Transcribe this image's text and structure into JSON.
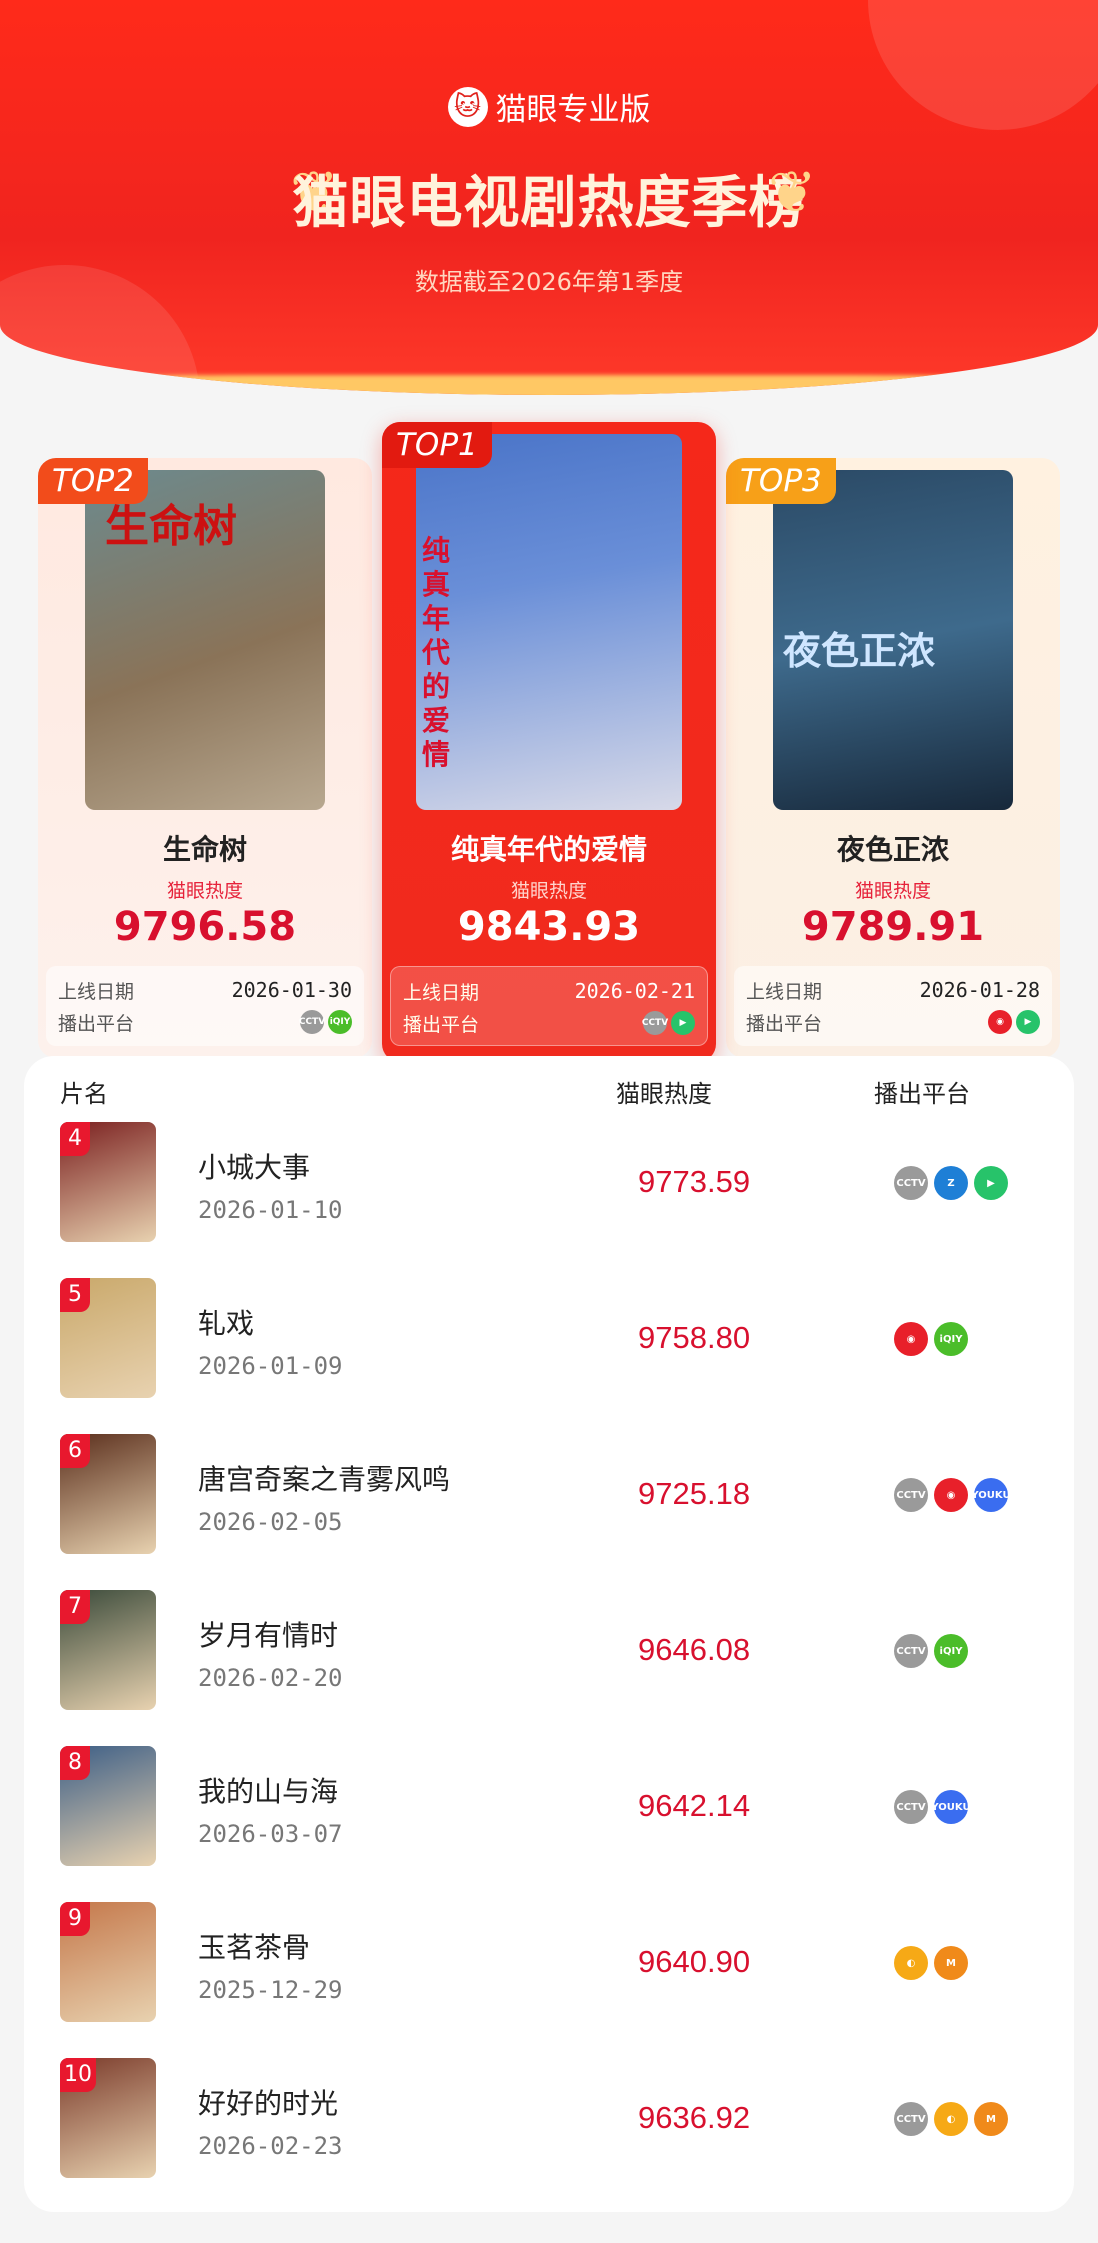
{
  "header": {
    "brand": "猫眼专业版",
    "title": "猫眼电视剧热度季榜",
    "subtitle": "数据截至2026年第1季度"
  },
  "labels": {
    "heat": "猫眼热度",
    "release_date": "上线日期",
    "platform": "播出平台",
    "col_name": "片名",
    "col_heat": "猫眼热度",
    "col_platform": "播出平台"
  },
  "top": [
    {
      "tag": "TOP1",
      "name": "纯真年代的爱情",
      "heat": "9843.93",
      "date": "2026-02-21",
      "poster_text": "纯真年代的爱情",
      "platforms": [
        "cctv-icon",
        "tencent-video-icon"
      ]
    },
    {
      "tag": "TOP2",
      "name": "生命树",
      "heat": "9796.58",
      "date": "2026-01-30",
      "poster_text": "生命树",
      "platforms": [
        "cctv-icon",
        "iqiyi-icon"
      ]
    },
    {
      "tag": "TOP3",
      "name": "夜色正浓",
      "heat": "9789.91",
      "date": "2026-01-28",
      "poster_text": "夜色正浓",
      "platforms": [
        "mgtv-red-icon",
        "tencent-video-icon"
      ]
    }
  ],
  "rows": [
    {
      "rank": "4",
      "name": "小城大事",
      "date": "2026-01-10",
      "heat": "9773.59",
      "platforms": [
        "cctv-icon",
        "zhejiang-tv-icon",
        "tencent-video-icon"
      ],
      "thumb": "#7a1f1f"
    },
    {
      "rank": "5",
      "name": "轧戏",
      "date": "2026-01-09",
      "heat": "9758.80",
      "platforms": [
        "mgtv-red-icon",
        "iqiyi-icon"
      ],
      "thumb": "#c9a86a"
    },
    {
      "rank": "6",
      "name": "唐宫奇案之青雾风鸣",
      "date": "2026-02-05",
      "heat": "9725.18",
      "platforms": [
        "cctv-icon",
        "mgtv-red-icon",
        "youku-icon"
      ],
      "thumb": "#5a2e1c"
    },
    {
      "rank": "7",
      "name": "岁月有情时",
      "date": "2026-02-20",
      "heat": "9646.08",
      "platforms": [
        "cctv-icon",
        "iqiyi-icon"
      ],
      "thumb": "#3a4a3a"
    },
    {
      "rank": "8",
      "name": "我的山与海",
      "date": "2026-03-07",
      "heat": "9642.14",
      "platforms": [
        "cctv-icon",
        "youku-icon"
      ],
      "thumb": "#3c5e86"
    },
    {
      "rank": "9",
      "name": "玉茗茶骨",
      "date": "2025-12-29",
      "heat": "9640.90",
      "platforms": [
        "hunan-tv-icon",
        "mango-tv-icon"
      ],
      "thumb": "#c4774a"
    },
    {
      "rank": "10",
      "name": "好好的时光",
      "date": "2026-02-23",
      "heat": "9636.92",
      "platforms": [
        "cctv-icon",
        "hunan-tv-icon",
        "mango-tv-icon"
      ],
      "thumb": "#7a3a2a"
    }
  ],
  "platform_icons": {
    "cctv-icon": {
      "text": "CCTV",
      "color": "#9a9a9a"
    },
    "tencent-video-icon": {
      "text": "▶",
      "color": "#27c36a"
    },
    "iqiyi-icon": {
      "text": "iQIY",
      "color": "#4bbd2a"
    },
    "mgtv-red-icon": {
      "text": "◉",
      "color": "#e8202a"
    },
    "zhejiang-tv-icon": {
      "text": "Z",
      "color": "#1e7fd6"
    },
    "youku-icon": {
      "text": "YOUKU",
      "color": "#3a6df0"
    },
    "hunan-tv-icon": {
      "text": "◐",
      "color": "#f6a916"
    },
    "mango-tv-icon": {
      "text": "M",
      "color": "#f08a1a"
    }
  }
}
